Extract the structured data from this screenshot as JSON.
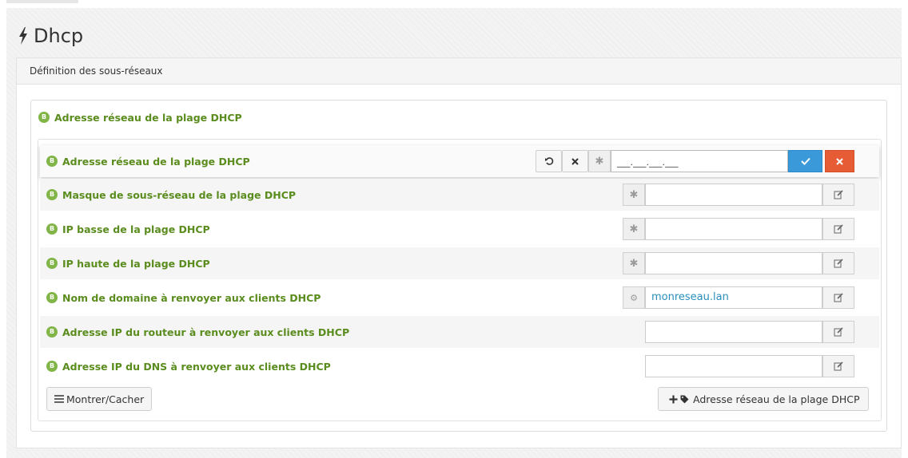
{
  "page": {
    "title": "Dhcp",
    "title_icon": "bolt-icon"
  },
  "panel": {
    "heading": "Définition des sous-réseaux"
  },
  "section": {
    "badge": "B",
    "title": "Adresse réseau de la plage DHCP"
  },
  "rows": [
    {
      "badge": "B",
      "label": "Adresse réseau de la plage DHCP",
      "value": "",
      "mask": "___.___.___.___",
      "editing": true
    },
    {
      "badge": "B",
      "label": "Masque de sous-réseau de la plage DHCP",
      "value": ""
    },
    {
      "badge": "B",
      "label": "IP basse de la plage DHCP",
      "value": ""
    },
    {
      "badge": "B",
      "label": "IP haute de la plage DHCP",
      "value": ""
    },
    {
      "badge": "B",
      "label": "Nom de domaine à renvoyer aux clients DHCP",
      "value": "monreseau.lan"
    },
    {
      "badge": "B",
      "label": "Adresse IP du routeur à renvoyer aux clients DHCP",
      "value": ""
    },
    {
      "badge": "B",
      "label": "Adresse IP du DNS à renvoyer aux clients DHCP",
      "value": ""
    }
  ],
  "footer": {
    "toggle_label": "Montrer/Cacher",
    "add_label": "Adresse réseau de la plage DHCP"
  },
  "colors": {
    "label_green": "#5a8c1e",
    "badge_green": "#82b548",
    "confirm_blue": "#3a9ad9",
    "cancel_red": "#e55c35",
    "value_blue": "#2a8fbd"
  }
}
